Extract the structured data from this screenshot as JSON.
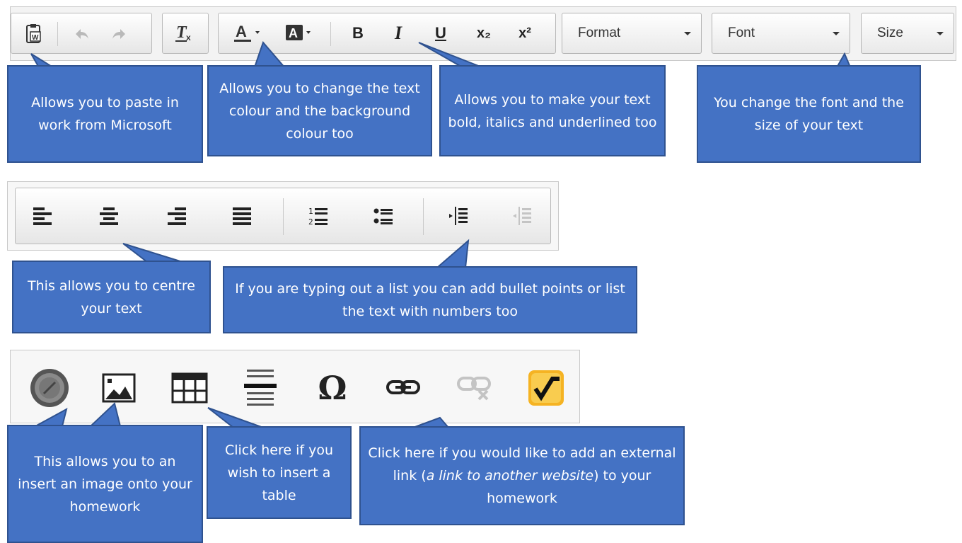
{
  "toolbar1": {
    "buttons": {
      "paste_word": "paste-from-word-icon",
      "undo": "undo-icon",
      "redo": "redo-icon",
      "remove_format": "remove-format-icon",
      "text_colour": "text-colour-icon",
      "bg_colour": "background-colour-icon",
      "bold": "B",
      "italic": "I",
      "underline": "U",
      "subscript": "x₂",
      "superscript": "x²"
    },
    "format_label": "Format",
    "font_label": "Font",
    "size_label": "Size"
  },
  "toolbar2": {
    "buttons": [
      "align-left-icon",
      "align-centre-icon",
      "align-right-icon",
      "justify-icon",
      "numbered-list-icon",
      "bullet-list-icon",
      "indent-icon",
      "outdent-icon"
    ]
  },
  "toolbar3": {
    "buttons": [
      "source-icon",
      "image-icon",
      "table-icon",
      "horizontal-line-icon",
      "special-character-icon",
      "link-icon",
      "unlink-icon",
      "math-equation-icon"
    ],
    "omega": "Ω"
  },
  "callouts": {
    "paste": "Allows you to paste in work from Microsoft",
    "colour": "Allows you to change the text colour and the background colour too",
    "bold": "Allows you to make your text bold, italics and underlined too",
    "font": "You change the font and the size of your text",
    "centre": "This allows you to centre your text",
    "list": "If you are typing out a list you can add bullet points or list the text with numbers too",
    "image": "This allows you to an insert an image onto your homework",
    "table": "Click here if you wish to insert a table",
    "link_before": "Click here if you would like to add an external link (",
    "link_italic": "a link to another website",
    "link_after": ") to your homework"
  },
  "colors": {
    "callout_fill": "#4472c4",
    "callout_border": "#2f528f"
  }
}
